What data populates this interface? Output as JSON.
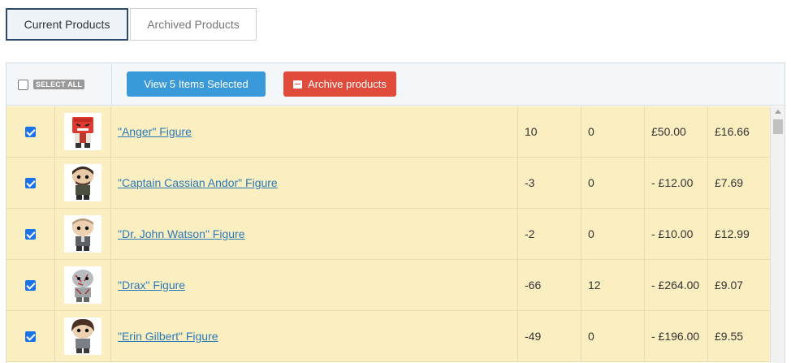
{
  "tabs": {
    "current": "Current Products",
    "archived": "Archived Products"
  },
  "toolbar": {
    "select_all": "SELECT ALL",
    "view_selected": "View 5 Items Selected",
    "archive": "Archive products"
  },
  "products": [
    {
      "name": "\"Anger\" Figure",
      "col1": "10",
      "col2": "0",
      "col3": "£50.00",
      "col4": "£16.66",
      "checked": true,
      "figure": "anger"
    },
    {
      "name": "\"Captain Cassian Andor\" Figure",
      "col1": "-3",
      "col2": "0",
      "col3": "- £12.00",
      "col4": "£7.69",
      "checked": true,
      "figure": "cassian"
    },
    {
      "name": "\"Dr. John Watson\" Figure",
      "col1": "-2",
      "col2": "0",
      "col3": "- £10.00",
      "col4": "£12.99",
      "checked": true,
      "figure": "watson"
    },
    {
      "name": "\"Drax\" Figure",
      "col1": "-66",
      "col2": "12",
      "col3": "- £264.00",
      "col4": "£9.07",
      "checked": true,
      "figure": "drax"
    },
    {
      "name": "\"Erin Gilbert\" Figure",
      "col1": "-49",
      "col2": "0",
      "col3": "- £196.00",
      "col4": "£9.55",
      "checked": true,
      "figure": "erin"
    }
  ],
  "colors": {
    "row_bg": "#fbeec1",
    "view_btn": "#3a9ad9",
    "archive_btn": "#e04b3b",
    "link": "#2a7ab9"
  }
}
